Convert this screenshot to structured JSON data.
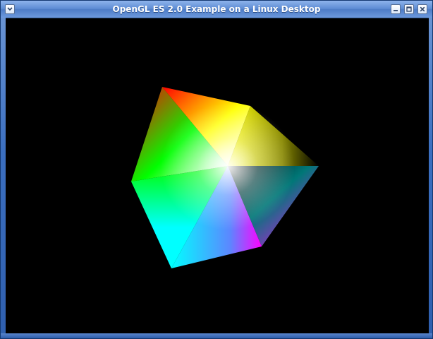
{
  "window": {
    "title": "OpenGL ES 2.0 Example on a Linux Desktop",
    "controls": {
      "window_menu": "chevron-down-icon",
      "minimize": "minimize-icon",
      "maximize": "maximize-icon",
      "close": "close-icon"
    }
  },
  "scene": {
    "background": "#000000",
    "object": "rgb-color-cube",
    "visible_corner_colors": [
      "#ff0000",
      "#ffff00",
      "#00ff00",
      "#00ffff",
      "#ff00ff",
      "#000000",
      "#ffffff"
    ]
  }
}
